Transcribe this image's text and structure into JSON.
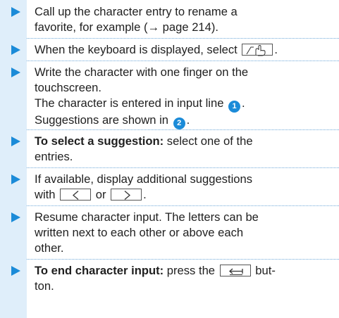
{
  "steps": [
    {
      "lines": [
        "Call up the character entry to rename a",
        "favorite, for example (→ page 214)."
      ]
    },
    {
      "text_before": "When the keyboard is displayed, select",
      "key_icon": "handwriting-hand-icon",
      "text_after": "."
    },
    {
      "lines": [
        "Write the character with one finger on the",
        "touchscreen."
      ],
      "line3_before": "The character is entered in input line",
      "callout_1": "1",
      "line3_after": ".",
      "line4_before": "Suggestions are shown in",
      "callout_2": "2",
      "line4_after": "."
    },
    {
      "bold": "To select a suggestion:",
      "rest": " select one of the",
      "line2": "entries."
    },
    {
      "line1": "If available, display additional suggestions",
      "with": "with",
      "key_left_icon": "chevron-left-icon",
      "or": "or",
      "key_right_icon": "chevron-right-icon",
      "end": "."
    },
    {
      "lines": [
        "Resume character input. The letters can be",
        "written next to each other or above each",
        "other."
      ]
    },
    {
      "bold": "To end character input:",
      "press": " press the",
      "key_icon": "backspace-arrow-icon",
      "tail": " but-",
      "line2": "ton."
    }
  ],
  "colors": {
    "accent": "#1b8bd8",
    "sidebar": "#dfeefa",
    "text": "#1f1f1f"
  }
}
